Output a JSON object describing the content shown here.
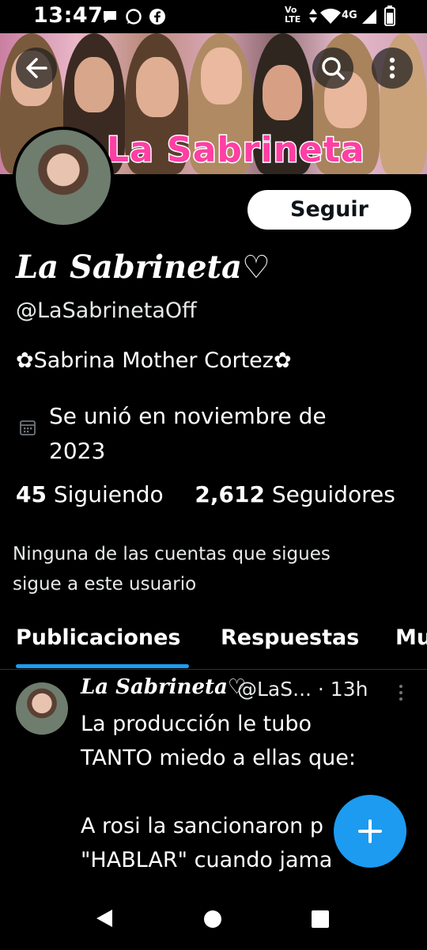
{
  "status_bar": {
    "time": "13:47",
    "network_top": "Vo",
    "network_bottom": "LTE",
    "signal_type": "4G",
    "icons": [
      "chat-bubble-icon",
      "whatsapp-icon",
      "facebook-icon",
      "vibrate-icon",
      "wifi-icon",
      "signal-icon",
      "battery-icon"
    ]
  },
  "banner": {
    "title": "La Sabrineta"
  },
  "header_buttons": {
    "back_icon": "back-arrow-icon",
    "search_icon": "search-icon",
    "more_icon": "more-vertical-icon"
  },
  "profile": {
    "follow_label": "Seguir",
    "display_name": "La Sabrineta♡",
    "handle": "@LaSabrinetaOff",
    "bio": "✿Sabrina Mother Cortez✿",
    "join_line1": "Se unió en noviembre de",
    "join_line2": "2023",
    "following_count": "45",
    "following_label": "Siguiendo",
    "followers_count": "2,612",
    "followers_label": "Seguidores",
    "mutual_line1": "Ninguna de las cuentas que sigues",
    "mutual_line2": "sigue a este usuario"
  },
  "tabs": [
    {
      "label": "Publicaciones",
      "active": true
    },
    {
      "label": "Respuestas",
      "active": false
    },
    {
      "label": "Mu",
      "active": false
    }
  ],
  "post": {
    "author": "La Sabrineta♡",
    "meta": "@LaS... · 13h",
    "text": "La producción le tubo\nTANTO miedo a ellas que:\n\nA rosi la sancionaron p\n\"HABLAR\" cuando jama\nhablo"
  },
  "fab": {
    "icon": "plus-icon"
  },
  "nav_bar": {
    "icons": [
      "back-triangle-icon",
      "home-circle-icon",
      "recents-square-icon"
    ]
  },
  "colors": {
    "accent": "#1d9bf0",
    "background": "#000000",
    "banner_title": "#ff3fa4"
  }
}
